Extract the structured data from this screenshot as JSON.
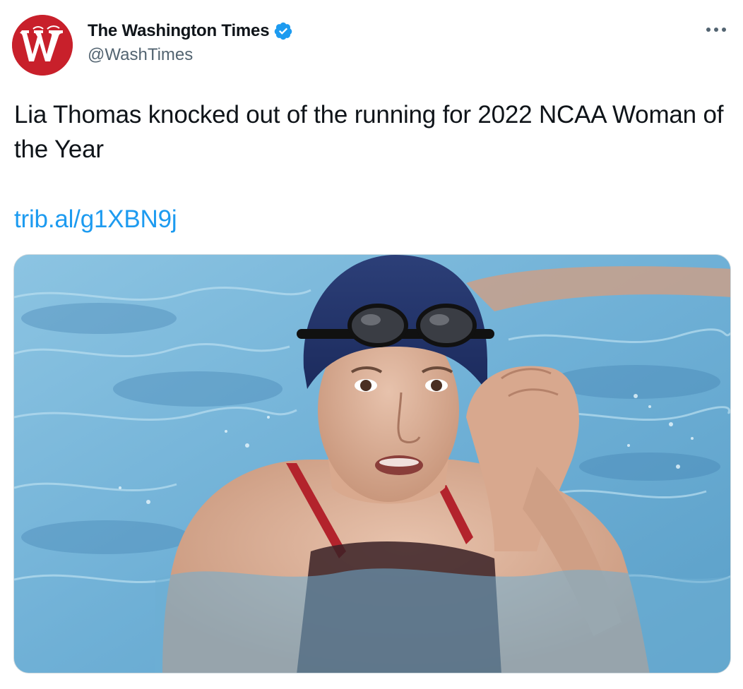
{
  "tweet": {
    "author": {
      "display_name": "The Washington Times",
      "handle": "@WashTimes",
      "verified": true,
      "avatar_letter": "W",
      "avatar_color": "#c8202b"
    },
    "text": "Lia Thomas knocked out of the running for 2022 NCAA Woman of the Year",
    "link": "trib.al/g1XBN9j",
    "link_color": "#1d9bf0",
    "more_icon": "more-horizontal-icon",
    "media": {
      "type": "photo",
      "description_icon": "photo"
    }
  },
  "colors": {
    "text": "#0f1419",
    "secondary_text": "#536471",
    "verified": "#1d9bf0",
    "water": "#7fbcdd"
  }
}
